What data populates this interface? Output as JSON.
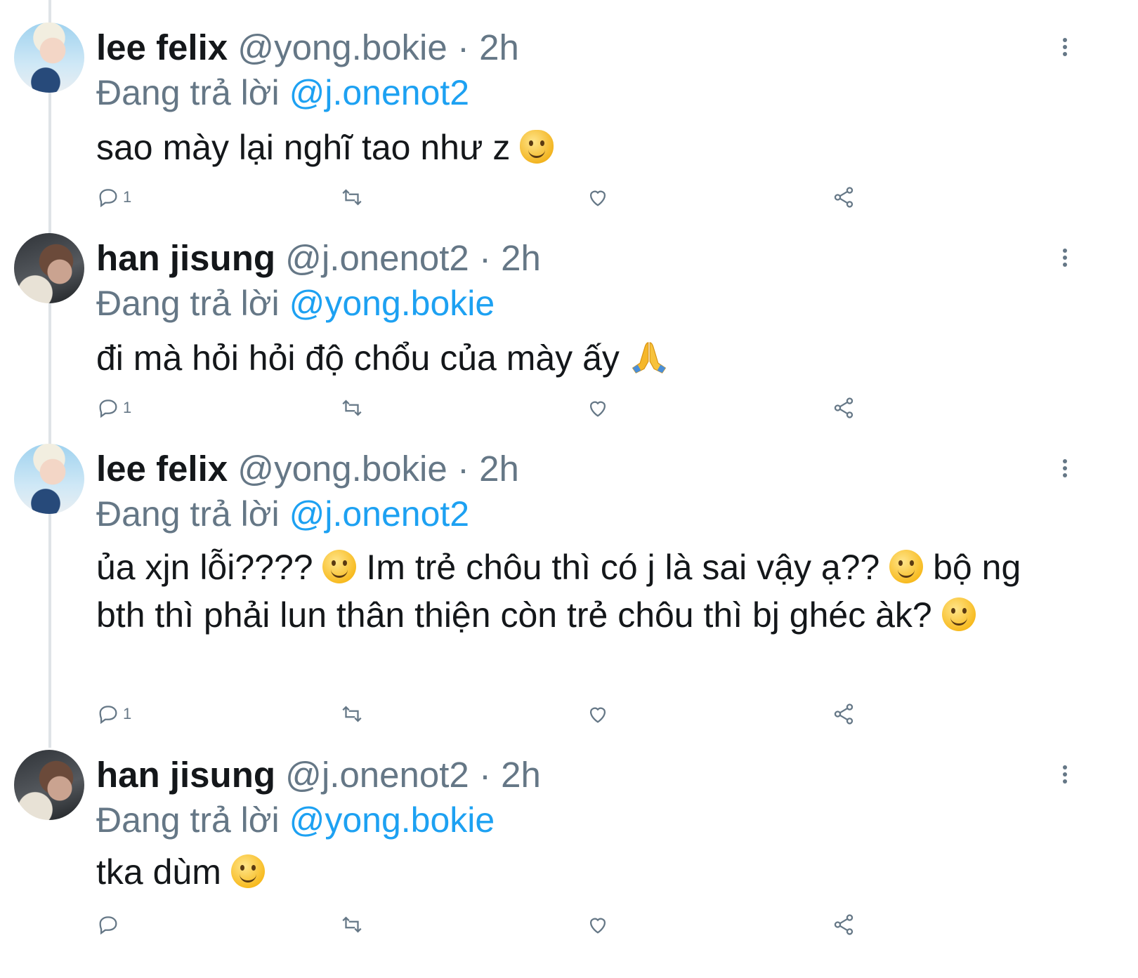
{
  "reply_prefix": "Đang trả lời",
  "tweets": [
    {
      "name": "lee felix",
      "handle": "@yong.bokie",
      "separator": "·",
      "time": "2h",
      "replying_to": "@j.onenot2",
      "text": "sao mày lại nghĩ tao như z",
      "emoji": "😾",
      "reply_count": "1",
      "avatar": "felix"
    },
    {
      "name": "han jisung",
      "handle": "@j.onenot2",
      "separator": "·",
      "time": "2h",
      "replying_to": "@yong.bokie",
      "text": "đi mà hỏi hỏi độ chổu của mày ấy",
      "emoji": "🙏",
      "reply_count": "1",
      "avatar": "jisung"
    },
    {
      "name": "lee felix",
      "handle": "@yong.bokie",
      "separator": "·",
      "time": "2h",
      "replying_to": "@j.onenot2",
      "text_parts": [
        "ủa xjn lỗi????",
        "Im trẻ chôu thì có j là sai vậy ạ??",
        "bộ ng bth thì phải lun thân thiện còn trẻ chôu thì bj ghéc àk?"
      ],
      "emoji": "😁",
      "reply_count": "1",
      "avatar": "felix"
    },
    {
      "name": "han jisung",
      "handle": "@j.onenot2",
      "separator": "·",
      "time": "2h",
      "replying_to": "@yong.bokie",
      "text": "tka dùm",
      "emoji": "🙂",
      "reply_count": "",
      "avatar": "jisung"
    }
  ],
  "icons": [
    "reply-icon",
    "retweet-icon",
    "like-icon",
    "share-icon",
    "more-icon"
  ],
  "colors": {
    "name": "#14171a",
    "muted": "#657786",
    "mention": "#1da1f2",
    "thread_line": "#dfe3e7"
  }
}
